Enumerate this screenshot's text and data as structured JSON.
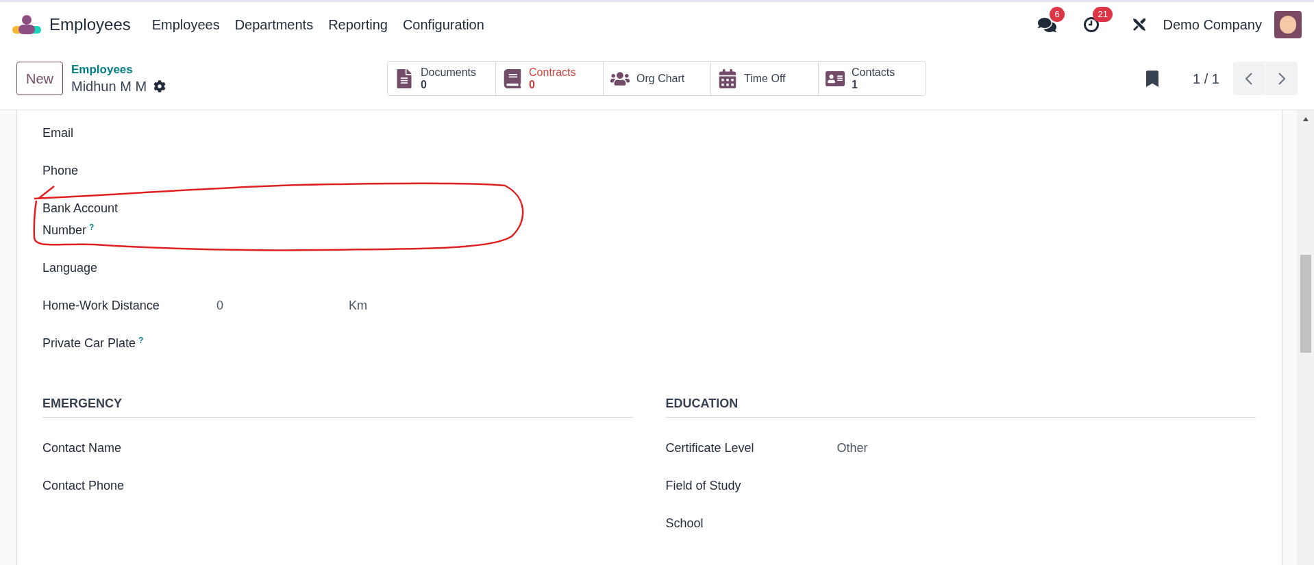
{
  "app": {
    "name": "Employees"
  },
  "menu": [
    {
      "label": "Employees"
    },
    {
      "label": "Departments"
    },
    {
      "label": "Reporting"
    },
    {
      "label": "Configuration"
    }
  ],
  "systray": {
    "messages_badge": "6",
    "activities_badge": "21",
    "company": "Demo Company"
  },
  "control_panel": {
    "new_button": "New",
    "breadcrumb": "Employees",
    "record_name": "Midhun M M",
    "smart_buttons": [
      {
        "label": "Documents",
        "value": "0",
        "alert": false
      },
      {
        "label": "Contracts",
        "value": "0",
        "alert": true
      },
      {
        "label": "Org Chart",
        "alert": false
      },
      {
        "label": "Time Off",
        "alert": false
      },
      {
        "label": "Contacts",
        "value": "1",
        "alert": false
      }
    ],
    "pager": "1 / 1"
  },
  "private_fields": [
    {
      "label": "Email"
    },
    {
      "label": "Phone"
    },
    {
      "label": "Bank Account Number",
      "help": "?"
    },
    {
      "label": "Language"
    },
    {
      "label": "Home-Work Distance",
      "value": "0",
      "unit": "Km"
    },
    {
      "label": "Private Car Plate",
      "help": "?"
    }
  ],
  "sections": [
    {
      "title": "EMERGENCY",
      "fields": [
        {
          "label": "Contact Name"
        },
        {
          "label": "Contact Phone"
        }
      ]
    },
    {
      "title": "EDUCATION",
      "fields": [
        {
          "label": "Certificate Level",
          "value": "Other"
        },
        {
          "label": "Field of Study"
        },
        {
          "label": "School"
        }
      ]
    }
  ]
}
